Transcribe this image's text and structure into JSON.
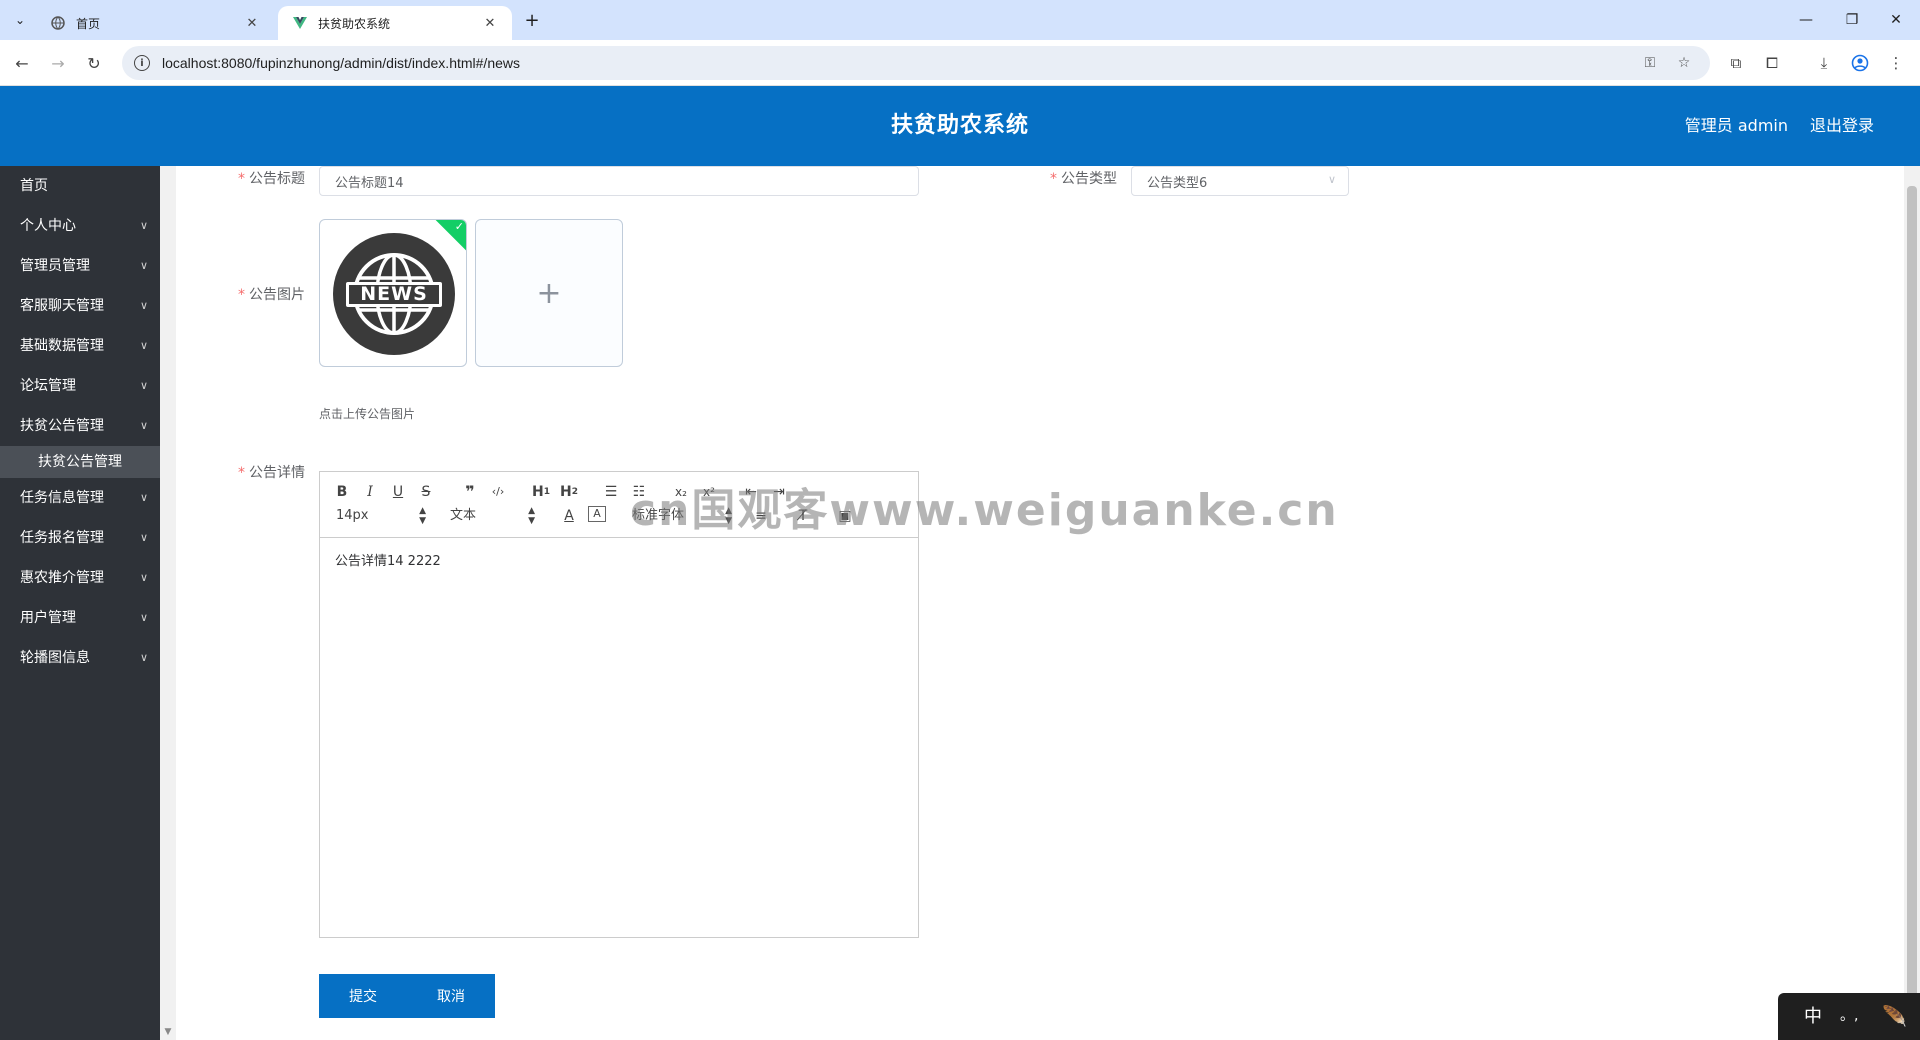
{
  "browser": {
    "tabs": [
      {
        "title": "首页",
        "active": false
      },
      {
        "title": "扶贫助农系统",
        "active": true
      }
    ],
    "url": "localhost:8080/fupinzhunong/admin/dist/index.html#/news"
  },
  "header": {
    "title": "扶贫助农系统",
    "user": "管理员 admin",
    "logout": "退出登录",
    "color": "#0670c4"
  },
  "sidebar": {
    "items": [
      {
        "label": "首页",
        "has_children": false
      },
      {
        "label": "个人中心",
        "has_children": true
      },
      {
        "label": "管理员管理",
        "has_children": true
      },
      {
        "label": "客服聊天管理",
        "has_children": true
      },
      {
        "label": "基础数据管理",
        "has_children": true
      },
      {
        "label": "论坛管理",
        "has_children": true
      },
      {
        "label": "扶贫公告管理",
        "has_children": true,
        "expanded": true
      },
      {
        "label": "任务信息管理",
        "has_children": true
      },
      {
        "label": "任务报名管理",
        "has_children": true
      },
      {
        "label": "惠农推介管理",
        "has_children": true
      },
      {
        "label": "用户管理",
        "has_children": true
      },
      {
        "label": "轮播图信息",
        "has_children": true
      }
    ],
    "active_submenu": "扶贫公告管理"
  },
  "form": {
    "title_label": "公告标题",
    "title_value": "公告标题14",
    "type_label": "公告类型",
    "type_value": "公告类型6",
    "image_label": "公告图片",
    "image_text": "NEWS",
    "upload_tip": "点击上传公告图片",
    "detail_label": "公告详情",
    "editor": {
      "font_size": "14px",
      "text_style": "文本",
      "font_family": "标准字体",
      "content": "公告详情14 2222"
    },
    "submit_label": "提交",
    "cancel_label": "取消"
  },
  "watermark": "cn国观客www.weiguanke.cn",
  "ime": {
    "mode": "中",
    "punct": "。,"
  }
}
